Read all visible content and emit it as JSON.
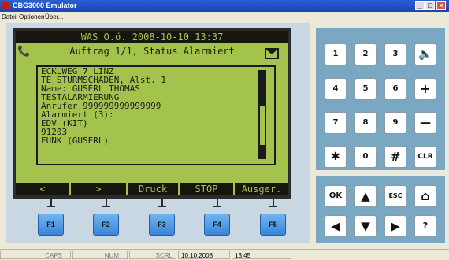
{
  "window": {
    "title": "CBG3000 Emulator",
    "buttons": [
      "_",
      "□",
      "×"
    ]
  },
  "menu": [
    "Datei",
    "Optionen",
    "Über..."
  ],
  "lcd": {
    "status": "WAS O.ö.  2008-10-10 13:37",
    "order_line": "Auftrag 1/1, Status Alarmiert",
    "phone_icon": "📞",
    "message_lines": [
      "ECKLWEG 7 LINZ",
      "TE STURMSCHADEN, Alst. 1",
      "Name: GUSERL THOMAS",
      "TESTALARMIERUNG",
      "Anrufer 999999999999999",
      "Alarmiert (3):",
      "EDV (KIT)",
      "91203",
      "FUNK (GUSERL)"
    ],
    "softkeys": [
      "<",
      ">",
      "Druck",
      "STOP",
      "Ausger."
    ]
  },
  "fbuttons": [
    "F1",
    "F2",
    "F3",
    "F4",
    "F5"
  ],
  "numpad": [
    [
      "1",
      "2",
      "3",
      "🔈"
    ],
    [
      "4",
      "5",
      "6",
      "+"
    ],
    [
      "7",
      "8",
      "9",
      "—"
    ],
    [
      "✱",
      "0",
      "#",
      "CLR"
    ]
  ],
  "navpad": [
    [
      "OK",
      "▲",
      "ESC",
      "⌂"
    ],
    [
      "◀",
      "▼",
      "▶",
      "?"
    ]
  ],
  "statusbar": [
    "CAPS",
    "NUM",
    "SCRL",
    "10.10.2008",
    "13:45"
  ]
}
